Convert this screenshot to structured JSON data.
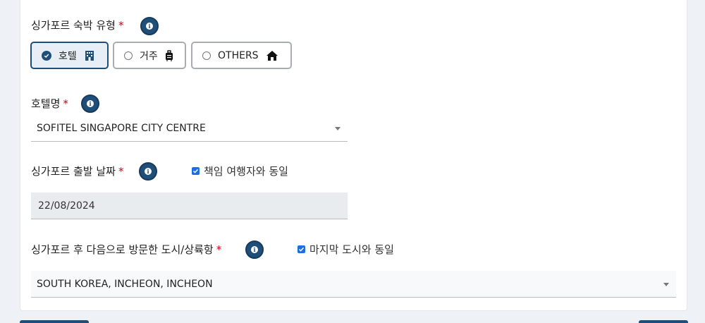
{
  "accommodation": {
    "label": "싱가포르 숙박 유형",
    "required_mark": "*",
    "options": [
      {
        "label": "호텔",
        "icon": "hotel-icon",
        "selected": true
      },
      {
        "label": "거주",
        "icon": "luggage-icon",
        "selected": false
      },
      {
        "label": "OTHERS",
        "icon": "home-icon",
        "selected": false
      }
    ]
  },
  "hotel": {
    "label": "호텔명",
    "required_mark": "*",
    "value": "SOFITEL SINGAPORE CITY CENTRE"
  },
  "departure": {
    "label": "싱가포르 출발 날짜",
    "required_mark": "*",
    "checkbox_label": "책임 여행자와 동일",
    "checkbox_checked": true,
    "value": "22/08/2024"
  },
  "next_city": {
    "label": "싱가포르 후 다음으로 방문한 도시/상륙항",
    "required_mark": "*",
    "checkbox_label": "마지막 도시와 동일",
    "checkbox_checked": true,
    "value": "SOUTH KOREA, INCHEON, INCHEON"
  },
  "colors": {
    "primary": "#1f4e79",
    "required": "#d0021b",
    "checkbox": "#1d6fe0",
    "disabled_bg": "#e9ecef"
  }
}
